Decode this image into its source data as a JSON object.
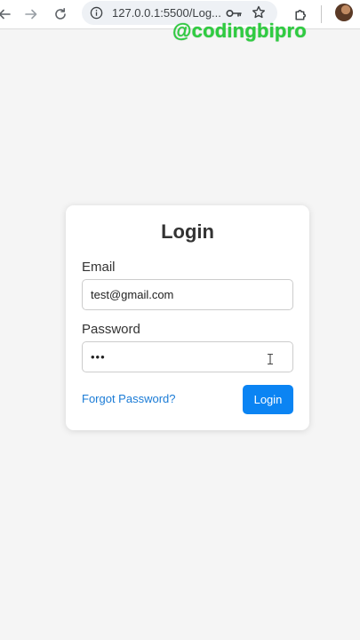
{
  "browser": {
    "url": "127.0.0.1:5500/Log...",
    "icons": {
      "back": "back-arrow-icon",
      "forward": "forward-arrow-icon",
      "reload": "reload-icon",
      "info": "info-icon",
      "key": "key-icon",
      "star": "star-icon",
      "extensions": "puzzle-icon",
      "profile": "avatar"
    }
  },
  "watermark": {
    "text": "@codingbipro",
    "color": "#2ecc40"
  },
  "login_form": {
    "title": "Login",
    "email_label": "Email",
    "email_value": "test@gmail.com",
    "password_label": "Password",
    "password_value": "•••",
    "forgot_link": "Forgot Password?",
    "submit_label": "Login"
  },
  "colors": {
    "page_background": "#f5f5f5",
    "card_background": "#ffffff",
    "accent_button": "#0b84f3",
    "link": "#1a7bd6",
    "text": "#333333"
  }
}
